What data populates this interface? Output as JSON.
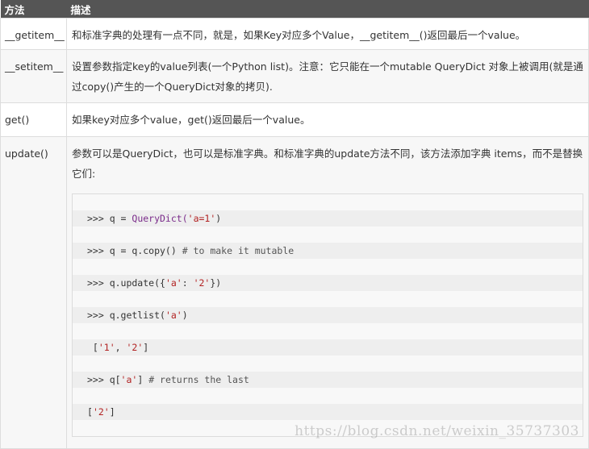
{
  "header": {
    "col_method": "方法",
    "col_desc": "描述"
  },
  "rows": [
    {
      "method": "__getitem__",
      "desc": "和标准字典的处理有一点不同，就是，如果Key对应多个Value，__getitem__()返回最后一个value。"
    },
    {
      "method": "__setitem__",
      "desc": "设置参数指定key的value列表(一个Python list)。注意：它只能在一个mutable QueryDict 对象上被调用(就是通过copy()产生的一个QueryDict对象的拷贝)."
    },
    {
      "method": "get()",
      "desc": "如果key对应多个value，get()返回最后一个value。"
    },
    {
      "method": "update()",
      "desc": "参数可以是QueryDict，也可以是标准字典。和标准字典的update方法不同，该方法添加字典 items，而不是替换它们:"
    }
  ],
  "code": {
    "l1_prompt": ">>> q = ",
    "l1_fn": "QueryDict(",
    "l1_str": "'a=1'",
    "l1_end": ")",
    "l2_prompt": ">>> q = q.copy() ",
    "l2_cmt": "# to make it mutable",
    "l3_prompt": ">>> q.update({",
    "l3_str1": "'a'",
    "l3_mid": ": ",
    "l3_str2": "'2'",
    "l3_end": "})",
    "l4_prompt": ">>> q.getlist(",
    "l4_str": "'a'",
    "l4_end": ")",
    "l5_open": " [",
    "l5_s1": "'1'",
    "l5_sep": ", ",
    "l5_s2": "'2'",
    "l5_close": "]",
    "l6_prompt": ">>> q[",
    "l6_str": "'a'",
    "l6_mid": "] ",
    "l6_cmt": "# returns the last",
    "l7_open": "[",
    "l7_s": "'2'",
    "l7_close": "]"
  },
  "watermark": "https://blog.csdn.net/weixin_35737303"
}
